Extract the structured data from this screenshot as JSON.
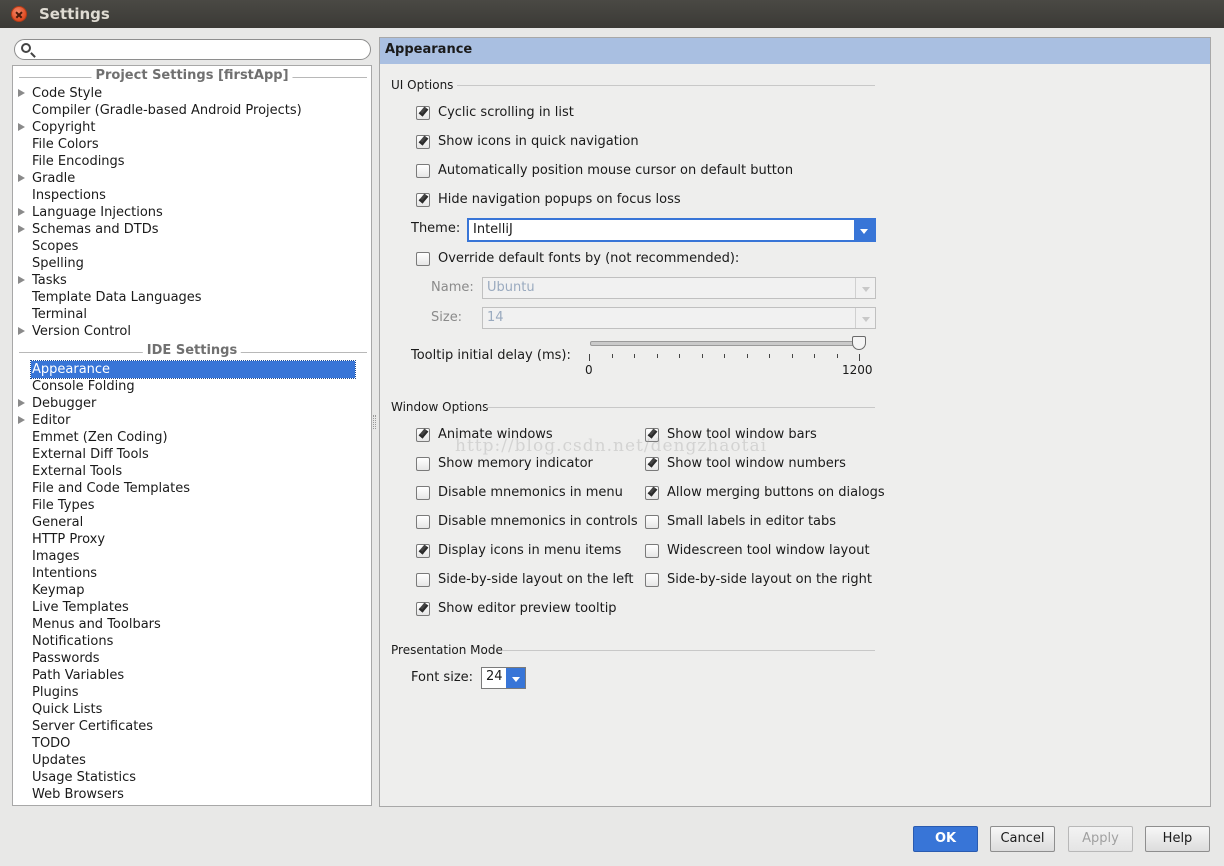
{
  "window": {
    "title": "Settings"
  },
  "search": {
    "placeholder": ""
  },
  "tree": {
    "project_header": "Project Settings [firstApp]",
    "project_items": [
      {
        "label": "Code Style",
        "expandable": true
      },
      {
        "label": "Compiler (Gradle-based Android Projects)",
        "expandable": false
      },
      {
        "label": "Copyright",
        "expandable": true
      },
      {
        "label": "File Colors",
        "expandable": false
      },
      {
        "label": "File Encodings",
        "expandable": false
      },
      {
        "label": "Gradle",
        "expandable": true
      },
      {
        "label": "Inspections",
        "expandable": false
      },
      {
        "label": "Language Injections",
        "expandable": true
      },
      {
        "label": "Schemas and DTDs",
        "expandable": true
      },
      {
        "label": "Scopes",
        "expandable": false
      },
      {
        "label": "Spelling",
        "expandable": false
      },
      {
        "label": "Tasks",
        "expandable": true
      },
      {
        "label": "Template Data Languages",
        "expandable": false
      },
      {
        "label": "Terminal",
        "expandable": false
      },
      {
        "label": "Version Control",
        "expandable": true
      }
    ],
    "ide_header": "IDE Settings",
    "ide_items": [
      {
        "label": "Appearance",
        "expandable": false,
        "selected": true
      },
      {
        "label": "Console Folding",
        "expandable": false
      },
      {
        "label": "Debugger",
        "expandable": true
      },
      {
        "label": "Editor",
        "expandable": true
      },
      {
        "label": "Emmet (Zen Coding)",
        "expandable": false
      },
      {
        "label": "External Diff Tools",
        "expandable": false
      },
      {
        "label": "External Tools",
        "expandable": false
      },
      {
        "label": "File and Code Templates",
        "expandable": false
      },
      {
        "label": "File Types",
        "expandable": false
      },
      {
        "label": "General",
        "expandable": false
      },
      {
        "label": "HTTP Proxy",
        "expandable": false
      },
      {
        "label": "Images",
        "expandable": false
      },
      {
        "label": "Intentions",
        "expandable": false
      },
      {
        "label": "Keymap",
        "expandable": false
      },
      {
        "label": "Live Templates",
        "expandable": false
      },
      {
        "label": "Menus and Toolbars",
        "expandable": false
      },
      {
        "label": "Notifications",
        "expandable": false
      },
      {
        "label": "Passwords",
        "expandable": false
      },
      {
        "label": "Path Variables",
        "expandable": false
      },
      {
        "label": "Plugins",
        "expandable": false
      },
      {
        "label": "Quick Lists",
        "expandable": false
      },
      {
        "label": "Server Certificates",
        "expandable": false
      },
      {
        "label": "TODO",
        "expandable": false
      },
      {
        "label": "Updates",
        "expandable": false
      },
      {
        "label": "Usage Statistics",
        "expandable": false
      },
      {
        "label": "Web Browsers",
        "expandable": false
      }
    ]
  },
  "panel": {
    "title": "Appearance",
    "ui_options": {
      "title": "UI Options",
      "checkboxes": [
        {
          "label": "Cyclic scrolling in list",
          "checked": true
        },
        {
          "label": "Show icons in quick navigation",
          "checked": true
        },
        {
          "label": "Automatically position mouse cursor on default button",
          "checked": false
        },
        {
          "label": "Hide navigation popups on focus loss",
          "checked": true
        }
      ],
      "theme_label": "Theme:",
      "theme_value": "IntelliJ",
      "override_fonts": {
        "label": "Override default fonts by (not recommended):",
        "checked": false
      },
      "name_label": "Name:",
      "name_value": "Ubuntu",
      "size_label": "Size:",
      "size_value": "14",
      "tooltip_label": "Tooltip initial delay (ms):",
      "tooltip_min": "0",
      "tooltip_max": "1200",
      "tooltip_value": 1200
    },
    "window_options": {
      "title": "Window Options",
      "left": [
        {
          "label": "Animate windows",
          "checked": true
        },
        {
          "label": "Show memory indicator",
          "checked": false
        },
        {
          "label": "Disable mnemonics in menu",
          "checked": false
        },
        {
          "label": "Disable mnemonics in controls",
          "checked": false
        },
        {
          "label": "Display icons in menu items",
          "checked": true
        },
        {
          "label": "Side-by-side layout on the left",
          "checked": false
        },
        {
          "label": "Show editor preview tooltip",
          "checked": true
        }
      ],
      "right": [
        {
          "label": "Show tool window bars",
          "checked": true
        },
        {
          "label": "Show tool window numbers",
          "checked": true
        },
        {
          "label": "Allow merging buttons on dialogs",
          "checked": true
        },
        {
          "label": "Small labels in editor tabs",
          "checked": false
        },
        {
          "label": "Widescreen tool window layout",
          "checked": false
        },
        {
          "label": "Side-by-side layout on the right",
          "checked": false
        }
      ]
    },
    "presentation": {
      "title": "Presentation Mode",
      "font_size_label": "Font size:",
      "font_size_value": "24"
    },
    "watermark": "http://blog.csdn.net/dengzhaotai"
  },
  "buttons": {
    "ok": "OK",
    "cancel": "Cancel",
    "apply": "Apply",
    "help": "Help"
  }
}
